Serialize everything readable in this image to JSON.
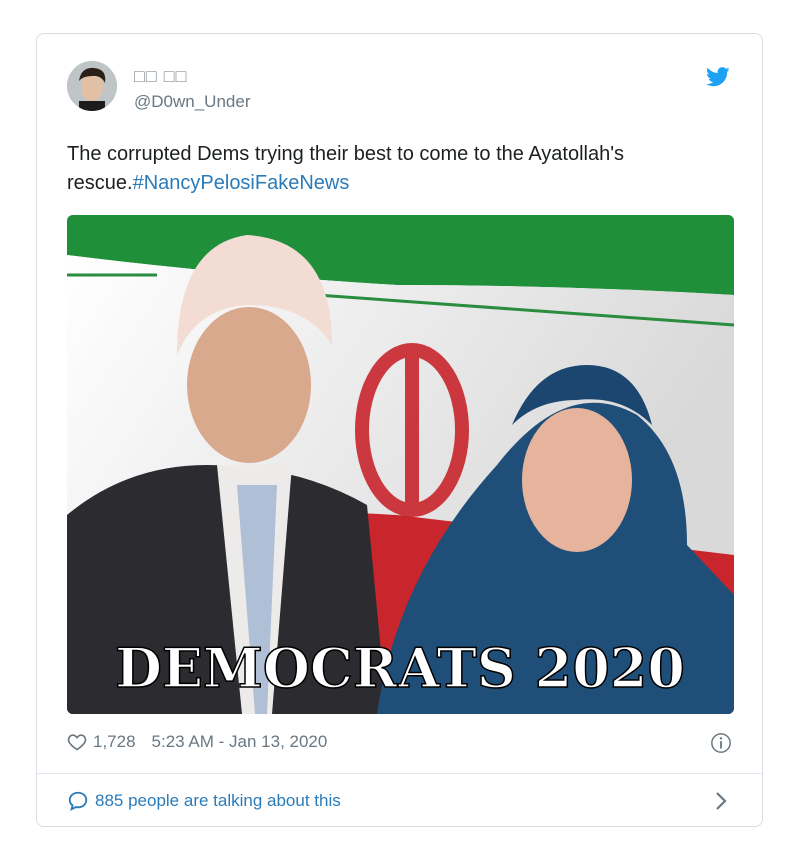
{
  "tweet": {
    "display_name": "□□ □□",
    "handle": "@D0wn_Under",
    "text": "The corrupted Dems trying their best to come to the Ayatollah's rescue.",
    "hashtag": "#NancyPelosiFakeNews",
    "image_caption": "DEMOCRATS 2020",
    "likes": "1,728",
    "timestamp": "5:23 AM - Jan 13, 2020",
    "talking": "885 people are talking about this"
  },
  "icons": {
    "brand": "twitter-bird-icon",
    "like": "heart-icon",
    "info": "info-icon",
    "reply": "speech-bubble-icon",
    "more": "chevron-right-icon"
  },
  "colors": {
    "link": "#2b7bb9",
    "twitter_blue": "#1da1f2",
    "muted": "#697882"
  }
}
